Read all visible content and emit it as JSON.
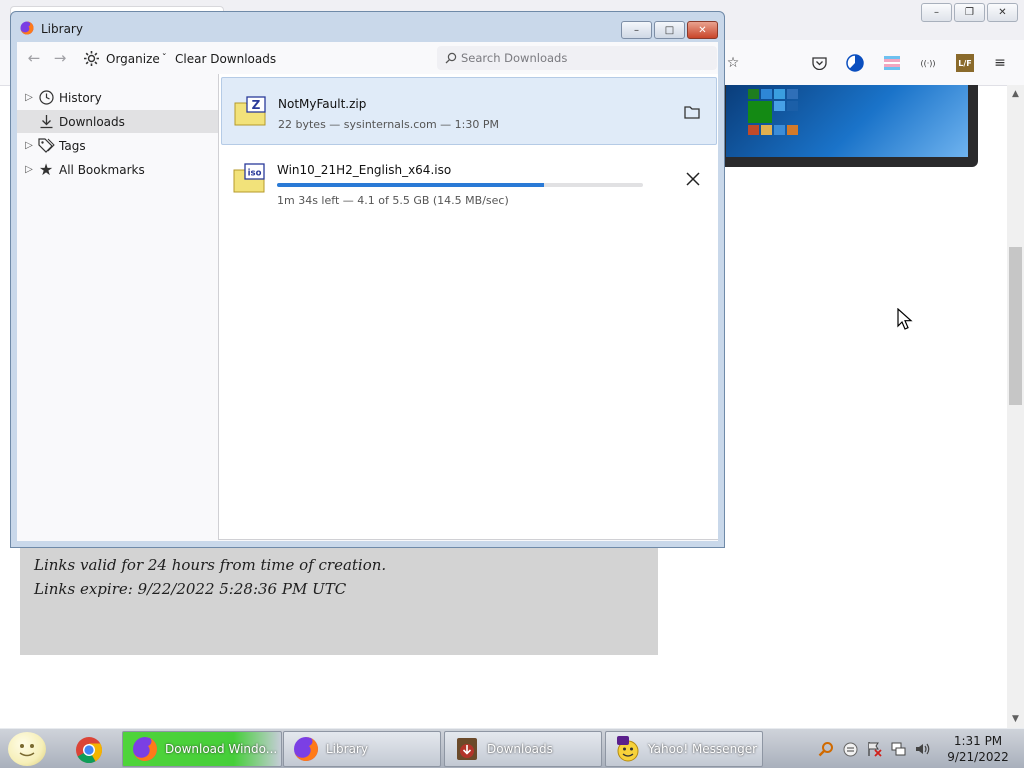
{
  "library": {
    "title": "Library",
    "window_buttons": {
      "minimize": "–",
      "maximize": "□",
      "close": "✕"
    },
    "toolbar": {
      "organize_label": "Organize",
      "organize_caret": "ˇ",
      "clear_label": "Clear Downloads",
      "search_placeholder": "Search Downloads",
      "search_value": ""
    },
    "sidebar": [
      {
        "label": "History",
        "icon": "clock-icon",
        "expandable": true
      },
      {
        "label": "Downloads",
        "icon": "download-icon",
        "expandable": false,
        "selected": true
      },
      {
        "label": "Tags",
        "icon": "tag-icon",
        "expandable": true
      },
      {
        "label": "All Bookmarks",
        "icon": "star-icon",
        "expandable": true
      }
    ],
    "downloads": [
      {
        "name": "NotMyFault.zip",
        "status": "22 bytes — sysinternals.com — 1:30 PM",
        "icon_label": "Z",
        "action": "folder-icon"
      },
      {
        "name": "Win10_21H2_English_x64.iso",
        "status": "1m 34s left — 4.1 of 5.5 GB (14.5 MB/sec)",
        "icon_label": "iso",
        "progress": 0.73,
        "action": "cancel-icon"
      }
    ]
  },
  "page": {
    "lines": [
      "Links valid for 24 hours from time of creation.",
      "Links expire: 9/22/2022 5:28:36 PM UTC"
    ]
  },
  "browser_toolbar": {
    "extension_label": "((·))",
    "lf_label": "L/F"
  },
  "taskbar": {
    "buttons": [
      {
        "label": "Download Windo...",
        "active": true
      },
      {
        "label": "Library",
        "active": false
      },
      {
        "label": "Downloads",
        "active": false
      },
      {
        "label": "Yahoo! Messenger",
        "active": false
      }
    ],
    "clock": {
      "time": "1:31 PM",
      "date": "9/21/2022"
    }
  },
  "colors": {
    "accent": "#2a7ad6",
    "selected_row": "#e0ebf8",
    "active_task": "#4fd43a"
  }
}
